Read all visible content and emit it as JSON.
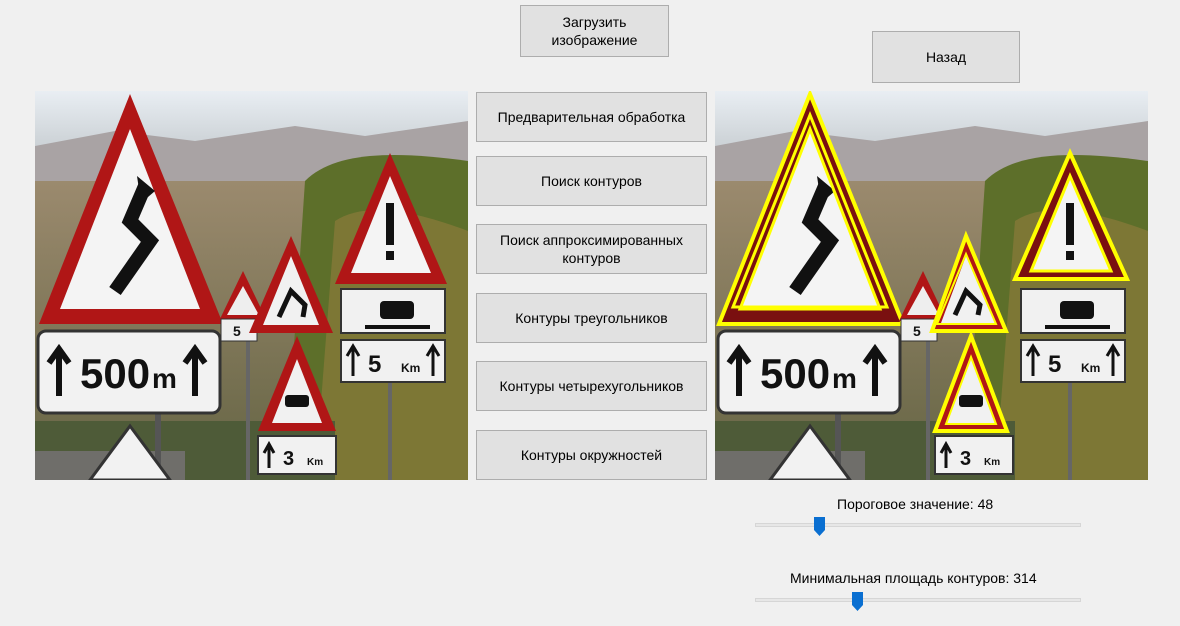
{
  "buttons": {
    "load": "Загрузить изображение",
    "back": "Назад",
    "preprocess": "Предварительная обработка",
    "find_contours": "Поиск контуров",
    "find_approx_contours": "Поиск аппроксимированных контуров",
    "triangle_contours": "Контуры треугольников",
    "quad_contours": "Контуры четырехугольников",
    "circle_contours": "Контуры окружностей"
  },
  "sliders": {
    "threshold": {
      "label": "Пороговое значение: 48",
      "min": 0,
      "max": 255,
      "value": 48
    },
    "min_area": {
      "label": "Минимальная площадь контуров: 314",
      "value": 314
    }
  },
  "images": {
    "original": {
      "sign_distance": "500",
      "sign_unit": "m",
      "sign_5": "5",
      "sign_5_unit": "Km",
      "sign_3": "3",
      "sign_3_unit": "Km"
    },
    "processed": {
      "sign_distance": "500",
      "sign_unit": "m",
      "sign_5": "5",
      "sign_5_unit": "Km",
      "sign_3": "3",
      "sign_3_unit": "Km",
      "contour_color": "#ffff00"
    }
  },
  "colors": {
    "sign_red": "#b01616",
    "accent_thumb": "#0a6fd1"
  }
}
